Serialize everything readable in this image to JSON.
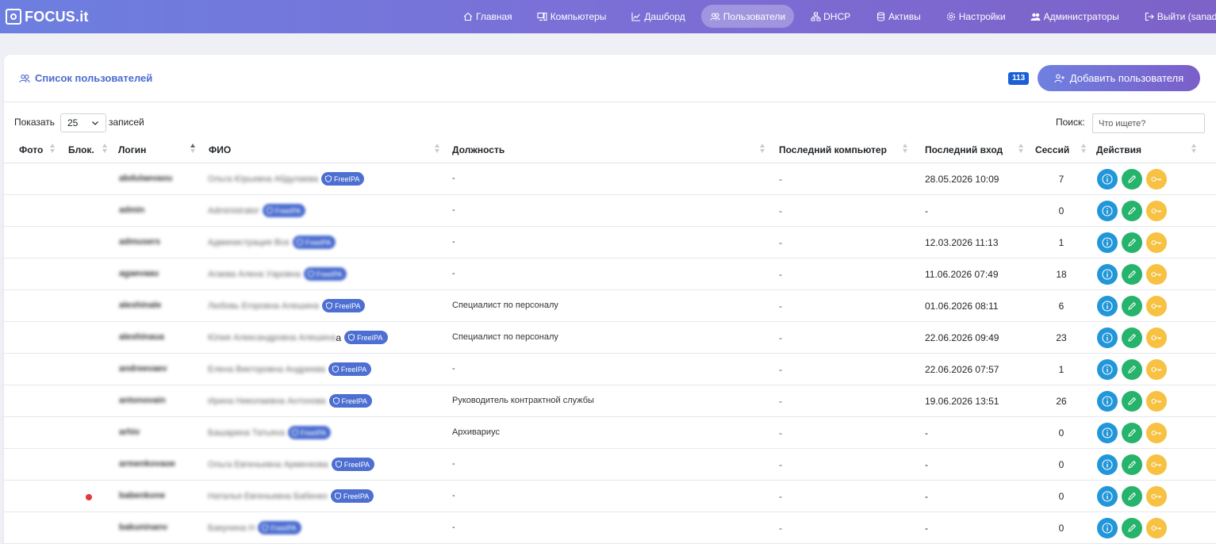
{
  "brand": "FOCUS.it",
  "nav": [
    {
      "label": "Главная",
      "icon": "home-icon",
      "active": false
    },
    {
      "label": "Компьютеры",
      "icon": "computer-icon",
      "active": false
    },
    {
      "label": "Дашборд",
      "icon": "chart-icon",
      "active": false
    },
    {
      "label": "Пользователи",
      "icon": "users-icon",
      "active": true
    },
    {
      "label": "DHCP",
      "icon": "network-icon",
      "active": false
    },
    {
      "label": "Активы",
      "icon": "database-icon",
      "active": false
    },
    {
      "label": "Настройки",
      "icon": "gear-icon",
      "active": false
    },
    {
      "label": "Администраторы",
      "icon": "admins-icon",
      "active": false
    },
    {
      "label": "Выйти (sanadmin)",
      "icon": "logout-icon",
      "active": false
    }
  ],
  "card": {
    "title": "Список пользователей",
    "count": "113",
    "add_button": "Добавить пользователя"
  },
  "controls": {
    "show_label": "Показать",
    "page_size": "25",
    "records_label": "записей",
    "search_label": "Поиск:",
    "search_placeholder": "Что ищете?"
  },
  "columns": {
    "photo": "Фото",
    "blocked": "Блок.",
    "login": "Логин",
    "fio": "ФИО",
    "position": "Должность",
    "last_computer": "Последний компьютер",
    "last_login": "Последний вход",
    "sessions": "Сессий",
    "actions": "Действия"
  },
  "freeipa_label": "FreeIPA",
  "rows": [
    {
      "login": "abdulaevaou",
      "fio": "Ольга Юрьевна Абдулаева",
      "fio_tail": "",
      "freeipa_blur": false,
      "position": "-",
      "computer": "-",
      "last_login": "28.05.2026 10:09",
      "sessions": "7",
      "blocked": false
    },
    {
      "login": "admin",
      "fio": "Administrator",
      "fio_tail": "",
      "freeipa_blur": true,
      "position": "-",
      "computer": "-",
      "last_login": "-",
      "sessions": "0",
      "blocked": false
    },
    {
      "login": "admusers",
      "fio": "Администрация Все",
      "fio_tail": "",
      "freeipa_blur": true,
      "position": "-",
      "computer": "-",
      "last_login": "12.03.2026 11:13",
      "sessions": "1",
      "blocked": false
    },
    {
      "login": "agaevaau",
      "fio": "Агаева Алена Уаровна",
      "fio_tail": "",
      "freeipa_blur": true,
      "position": "-",
      "computer": "-",
      "last_login": "11.06.2026 07:49",
      "sessions": "18",
      "blocked": false
    },
    {
      "login": "aleshinale",
      "fio": "Любовь Егоровна Алешина",
      "fio_tail": "",
      "freeipa_blur": false,
      "position": "Специалист по персоналу",
      "computer": "-",
      "last_login": "01.06.2026 08:11",
      "sessions": "6",
      "blocked": false
    },
    {
      "login": "aleshinaua",
      "fio": "Юлия Александровна Алешина",
      "fio_tail": "а",
      "freeipa_blur": false,
      "position": "Специалист по персоналу",
      "computer": "-",
      "last_login": "22.06.2026 09:49",
      "sessions": "23",
      "blocked": false
    },
    {
      "login": "andreevaev",
      "fio": "Елена Викторовна Андреева",
      "fio_tail": "",
      "freeipa_blur": false,
      "position": "-",
      "computer": "-",
      "last_login": "22.06.2026 07:57",
      "sessions": "1",
      "blocked": false
    },
    {
      "login": "antonovain",
      "fio": "Ирина Николаевна Антонова",
      "fio_tail": "",
      "freeipa_blur": false,
      "position": "Руководитель контрактной службы",
      "computer": "-",
      "last_login": "19.06.2026 13:51",
      "sessions": "26",
      "blocked": false
    },
    {
      "login": "arhiv",
      "fio": "Башарина Татьяна",
      "fio_tail": "",
      "freeipa_blur": true,
      "position": "Архивариус",
      "computer": "-",
      "last_login": "-",
      "sessions": "0",
      "blocked": false
    },
    {
      "login": "armenkovaoe",
      "fio": "Ольга Евгеньевна Арменкова",
      "fio_tail": "",
      "freeipa_blur": false,
      "position": "-",
      "computer": "-",
      "last_login": "-",
      "sessions": "0",
      "blocked": false
    },
    {
      "login": "babenkone",
      "fio": "Наталья Евгеньевна Бабенко",
      "fio_tail": "",
      "freeipa_blur": false,
      "position": "-",
      "computer": "-",
      "last_login": "-",
      "sessions": "0",
      "blocked": true
    },
    {
      "login": "bakuninanv",
      "fio": "Бакунина Н",
      "fio_tail": "",
      "freeipa_blur": true,
      "position": "-",
      "computer": "-",
      "last_login": "-",
      "sessions": "0",
      "blocked": false
    }
  ],
  "colors": {
    "accent": "#4a6bd0",
    "info": "#2196d9",
    "edit": "#26b36b",
    "key": "#f7c142",
    "badge": "#1a5fd6",
    "blocked": "#e23a3a"
  }
}
